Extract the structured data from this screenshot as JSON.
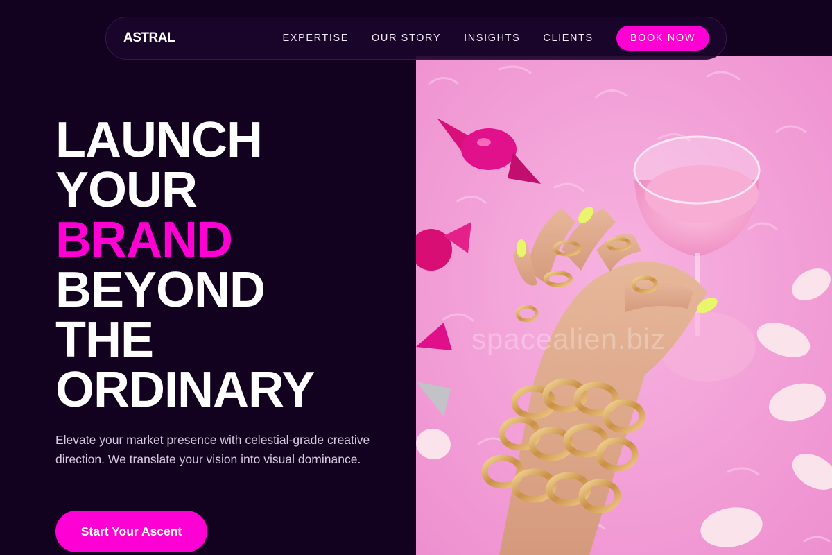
{
  "brand": {
    "logo": "ASTRAL"
  },
  "nav": {
    "links": [
      "EXPERTISE",
      "OUR STORY",
      "INSIGHTS",
      "CLIENTS"
    ],
    "cta": "BOOK NOW"
  },
  "hero": {
    "headline": [
      "LAUNCH",
      "YOUR",
      "BRAND",
      "BEYOND",
      "THE",
      "ORDINARY"
    ],
    "highlight_index": 2,
    "subtext": "Elevate your market presence with celestial-grade creative direction. We translate your vision into visual dominance.",
    "cta": "Start Your Ascent",
    "image_watermark": "spacealien.biz"
  },
  "colors": {
    "background": "#13021f",
    "accent": "#ff00d4",
    "text": "#ffffff",
    "muted_text": "#d8cbe0",
    "image_pink": "#f39ad5"
  }
}
